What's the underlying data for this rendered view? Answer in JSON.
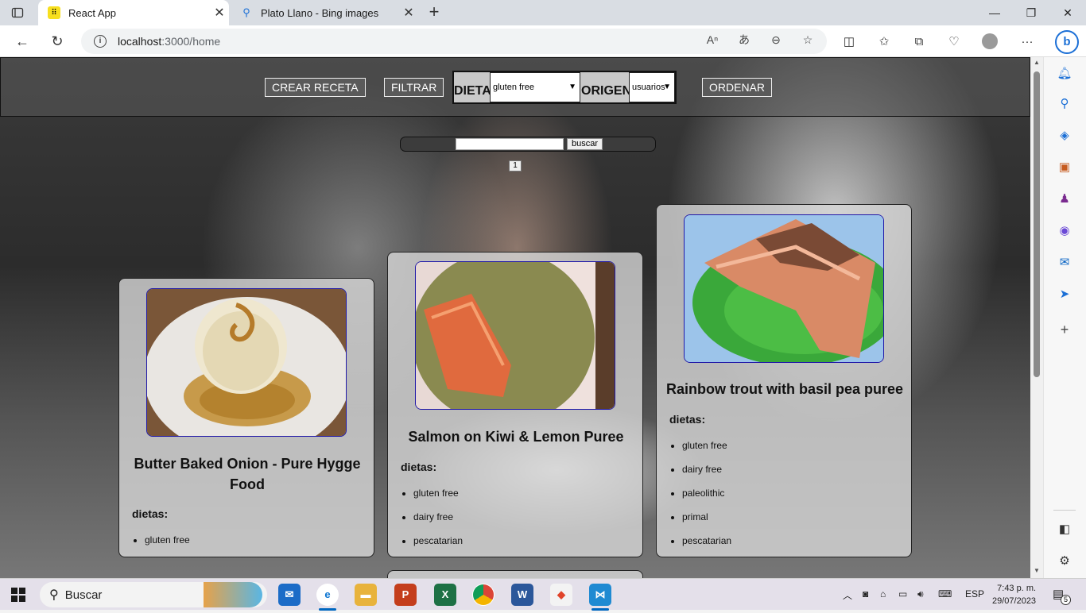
{
  "browser": {
    "tabs": [
      {
        "title": "React App",
        "active": true
      },
      {
        "title": "Plato Llano - Bing images",
        "active": false
      }
    ],
    "url_host": "localhost",
    "url_path": ":3000/home"
  },
  "page": {
    "buttons": {
      "crear": "CREAR RECETA",
      "filtrar": "FILTRAR",
      "ordenar": "ORDENAR",
      "buscar": "buscar"
    },
    "filters": {
      "dieta_label": "DIETA:",
      "dieta_value": "gluten free",
      "origen_label": "ORIGEN:",
      "origen_value": "usuarios"
    },
    "pagination": [
      "1"
    ],
    "cards": [
      {
        "title": "Butter Baked Onion - Pure Hygge Food",
        "dietas_label": "dietas:",
        "diets": [
          "gluten free"
        ]
      },
      {
        "title": "Salmon on Kiwi & Lemon Puree",
        "dietas_label": "dietas:",
        "diets": [
          "gluten free",
          "dairy free",
          "pescatarian"
        ]
      },
      {
        "title": "Rainbow trout with basil pea puree",
        "dietas_label": "dietas:",
        "diets": [
          "gluten free",
          "dairy free",
          "paleolithic",
          "primal",
          "pescatarian"
        ]
      }
    ]
  },
  "taskbar": {
    "search": "Buscar",
    "lang": "ESP",
    "time": "7:43 p. m.",
    "date": "29/07/2023",
    "notif_count": "5"
  }
}
